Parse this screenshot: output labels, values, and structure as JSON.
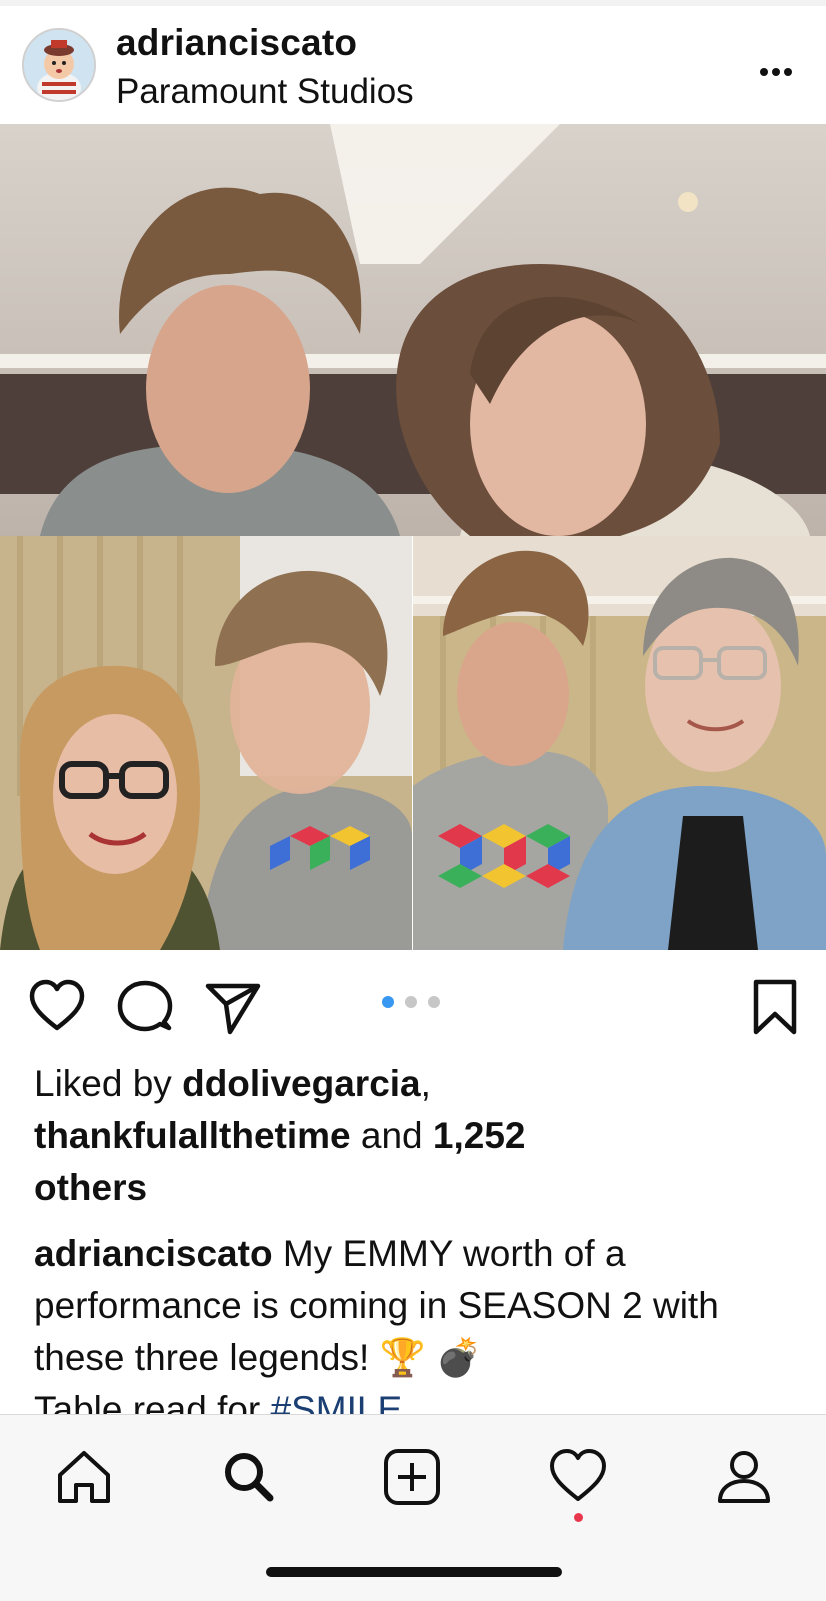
{
  "post": {
    "username": "adrianciscato",
    "location": "Paramount Studios"
  },
  "carousel": {
    "count": 3,
    "active_index": 0,
    "active_color": "#3897f0",
    "inactive_color": "#c7c7c7"
  },
  "likes": {
    "prefix": "Liked by ",
    "user1": "ddolivegarcia",
    "sep": ",",
    "user2": "thankfulallthetime",
    "middle": " and ",
    "count": "1,252",
    "suffix": "others"
  },
  "caption": {
    "username": "adrianciscato",
    "text": " My EMMY worth of a performance is coming in SEASON 2 with these three legends! 🏆 💣",
    "line2_prefix": "Table read for ",
    "hashtag": "#SMILE"
  },
  "icons": {
    "like": "heart-icon",
    "comment": "comment-bubble-icon",
    "share": "paper-plane-icon",
    "save": "bookmark-icon",
    "more": "more-dots-icon"
  },
  "tabbar": {
    "items": [
      "home-icon",
      "search-icon",
      "add-post-icon",
      "activity-heart-icon",
      "profile-icon"
    ],
    "active": "search-icon",
    "notification_color": "#e8374d"
  }
}
